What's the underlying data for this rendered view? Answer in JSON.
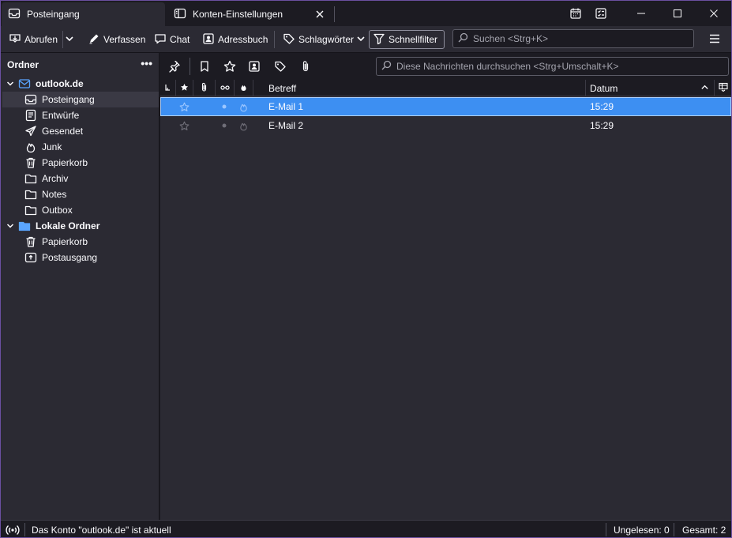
{
  "tabs": [
    {
      "label": "Posteingang",
      "icon": "inbox-icon",
      "active": true
    },
    {
      "label": "Konten-Einstellungen",
      "icon": "account-settings-icon",
      "active": false
    }
  ],
  "window_controls": {
    "calendar_icon": "calendar-icon",
    "tasks_icon": "tasks-icon"
  },
  "toolbar": {
    "get_messages": "Abrufen",
    "compose": "Verfassen",
    "chat": "Chat",
    "address_book": "Adressbuch",
    "tags": "Schlagwörter",
    "quick_filter": "Schnellfilter",
    "search_placeholder": "Suchen <Strg+K>"
  },
  "folder_pane": {
    "header": "Ordner",
    "more": "•••",
    "accounts": [
      {
        "name": "outlook.de",
        "folders": [
          {
            "name": "Posteingang",
            "icon": "inbox-icon",
            "selected": true
          },
          {
            "name": "Entwürfe",
            "icon": "drafts-icon"
          },
          {
            "name": "Gesendet",
            "icon": "sent-icon"
          },
          {
            "name": "Junk",
            "icon": "junk-icon"
          },
          {
            "name": "Papierkorb",
            "icon": "trash-icon"
          },
          {
            "name": "Archiv",
            "icon": "archive-icon"
          },
          {
            "name": "Notes",
            "icon": "folder-icon"
          },
          {
            "name": "Outbox",
            "icon": "folder-icon"
          }
        ]
      },
      {
        "name": "Lokale Ordner",
        "folders": [
          {
            "name": "Papierkorb",
            "icon": "trash-icon"
          },
          {
            "name": "Postausgang",
            "icon": "outbox-icon"
          }
        ]
      }
    ]
  },
  "quick_filter": {
    "search_placeholder": "Diese Nachrichten durchsuchen <Strg+Umschalt+K>"
  },
  "columns": {
    "subject": "Betreff",
    "date": "Datum"
  },
  "messages": [
    {
      "subject": "E-Mail 1",
      "date": "15:29",
      "selected": true
    },
    {
      "subject": "E-Mail 2",
      "date": "15:29",
      "selected": false
    }
  ],
  "status": {
    "message": "Das Konto \"outlook.de\" ist aktuell",
    "unread": "Ungelesen: 0",
    "total": "Gesamt: 2"
  },
  "colors": {
    "accent": "#3d8ff2",
    "folder_account_icon": "#5aa5ff",
    "background": "#1c1b22",
    "pane": "#2b2a33"
  }
}
